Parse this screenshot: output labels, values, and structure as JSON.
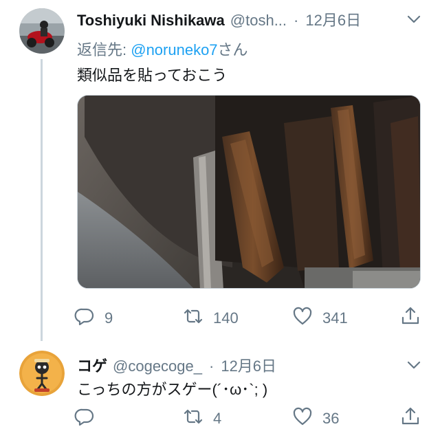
{
  "tweet1": {
    "display_name": "Toshiyuki Nishikawa",
    "handle": "@tosh...",
    "separator": "·",
    "date": "12月6日",
    "reply_prefix": "返信先: ",
    "reply_mention": "@noruneko7",
    "reply_suffix": "さん",
    "text": "類似品を貼っておこう",
    "actions": {
      "reply_count": "9",
      "retweet_count": "140",
      "like_count": "341"
    }
  },
  "tweet2": {
    "display_name": "コゲ",
    "handle": "@cogecoge_",
    "separator": "·",
    "date": "12月6日",
    "text": "こっちの方がスゲー(´･ω･`; )",
    "actions": {
      "reply_count": "",
      "retweet_count": "4",
      "like_count": "36"
    }
  },
  "colors": {
    "secondary_text": "#657786",
    "link": "#1da1f2",
    "thread_line": "#ccd6dd",
    "avatar2_bg": "#e8a33a"
  },
  "icons": [
    "reply-icon",
    "retweet-icon",
    "like-icon",
    "share-icon",
    "chevron-down-icon"
  ]
}
